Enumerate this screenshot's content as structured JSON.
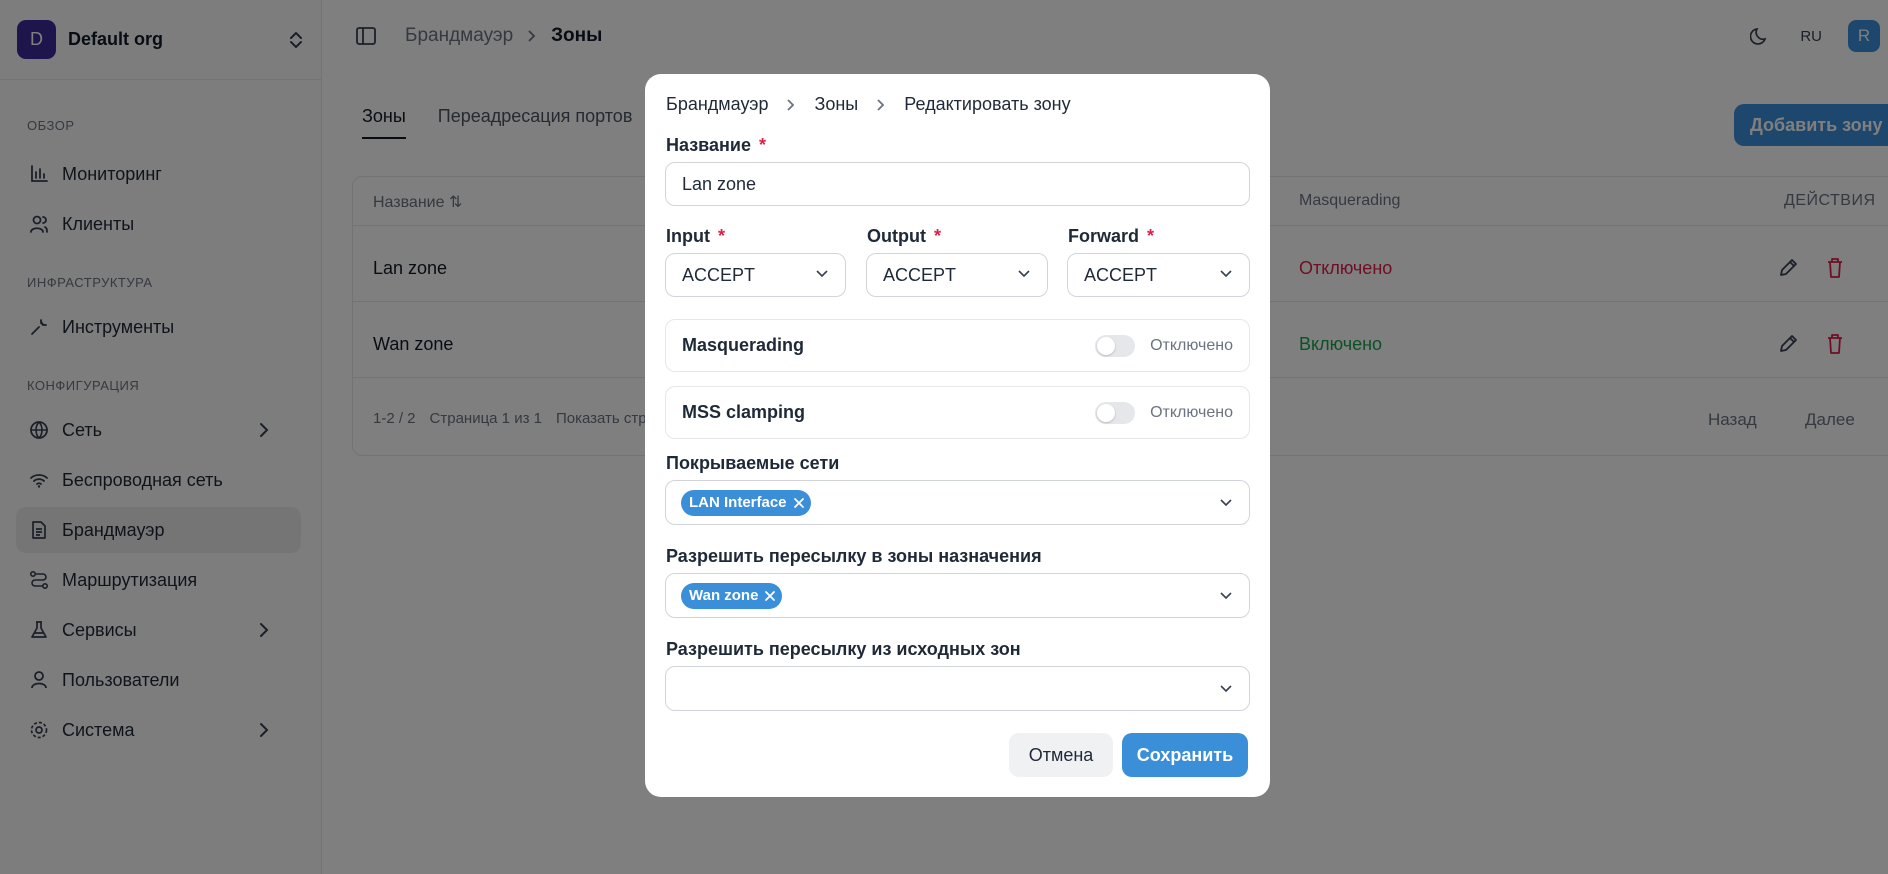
{
  "org": {
    "avatar_letter": "D",
    "name": "Default org"
  },
  "sidebar": {
    "sections": [
      {
        "title": "ОБЗОР",
        "items": [
          {
            "label": "Мониторинг",
            "icon": "chart-icon"
          },
          {
            "label": "Клиенты",
            "icon": "users-icon"
          }
        ]
      },
      {
        "title": "ИНФРАСТРУКТУРА",
        "items": [
          {
            "label": "Инструменты",
            "icon": "wrench-icon"
          }
        ]
      },
      {
        "title": "КОНФИГУРАЦИЯ",
        "items": [
          {
            "label": "Сеть",
            "icon": "globe-icon",
            "expandable": true
          },
          {
            "label": "Беспроводная сеть",
            "icon": "wifi-icon"
          },
          {
            "label": "Брандмауэр",
            "icon": "document-icon",
            "active": true
          },
          {
            "label": "Маршрутизация",
            "icon": "route-icon"
          },
          {
            "label": "Сервисы",
            "icon": "flask-icon",
            "expandable": true
          },
          {
            "label": "Пользователи",
            "icon": "user-icon"
          },
          {
            "label": "Система",
            "icon": "gear-icon",
            "expandable": true
          }
        ]
      }
    ]
  },
  "header": {
    "breadcrumb": [
      "Брандмауэр",
      "Зоны"
    ],
    "lang": "RU",
    "user_initial": "R"
  },
  "main": {
    "tabs": [
      "Зоны",
      "Переадресация портов"
    ],
    "add_button": "Добавить зону",
    "table": {
      "columns": {
        "name": "Название",
        "masquerading": "Masquerading",
        "actions": "ДЕЙСТВИЯ"
      },
      "rows": [
        {
          "name": "Lan zone",
          "masquerading": "Отключено",
          "masq_color": "#e11d48"
        },
        {
          "name": "Wan zone",
          "masquerading": "Включено",
          "masq_color": "#16a34a"
        }
      ],
      "footer": {
        "range": "1-2 / 2",
        "page": "Страница 1 из 1",
        "show": "Показать стр",
        "prev": "Назад",
        "next": "Далее"
      }
    }
  },
  "modal": {
    "breadcrumb": [
      "Брандмауэр",
      "Зоны",
      "Редактировать зону"
    ],
    "name_label": "Название",
    "name_value": "Lan zone",
    "input_label": "Input",
    "input_value": "ACCEPT",
    "output_label": "Output",
    "output_value": "ACCEPT",
    "forward_label": "Forward",
    "forward_value": "ACCEPT",
    "masquerading": {
      "label": "Masquerading",
      "state": "Отключено",
      "on": false
    },
    "mss": {
      "label": "MSS clamping",
      "state": "Отключено",
      "on": false
    },
    "networks_label": "Покрываемые сети",
    "networks": [
      "LAN Interface"
    ],
    "fwd_dest_label": "Разрешить пересылку в зоны назначения",
    "fwd_dest": [
      "Wan zone"
    ],
    "fwd_src_label": "Разрешить пересылку из исходных зон",
    "fwd_src": [],
    "cancel": "Отмена",
    "save": "Сохранить"
  },
  "colors": {
    "accent": "#3b8fd9",
    "org_avatar": "#3b2a99",
    "danger": "#e11d48",
    "success": "#16a34a"
  }
}
